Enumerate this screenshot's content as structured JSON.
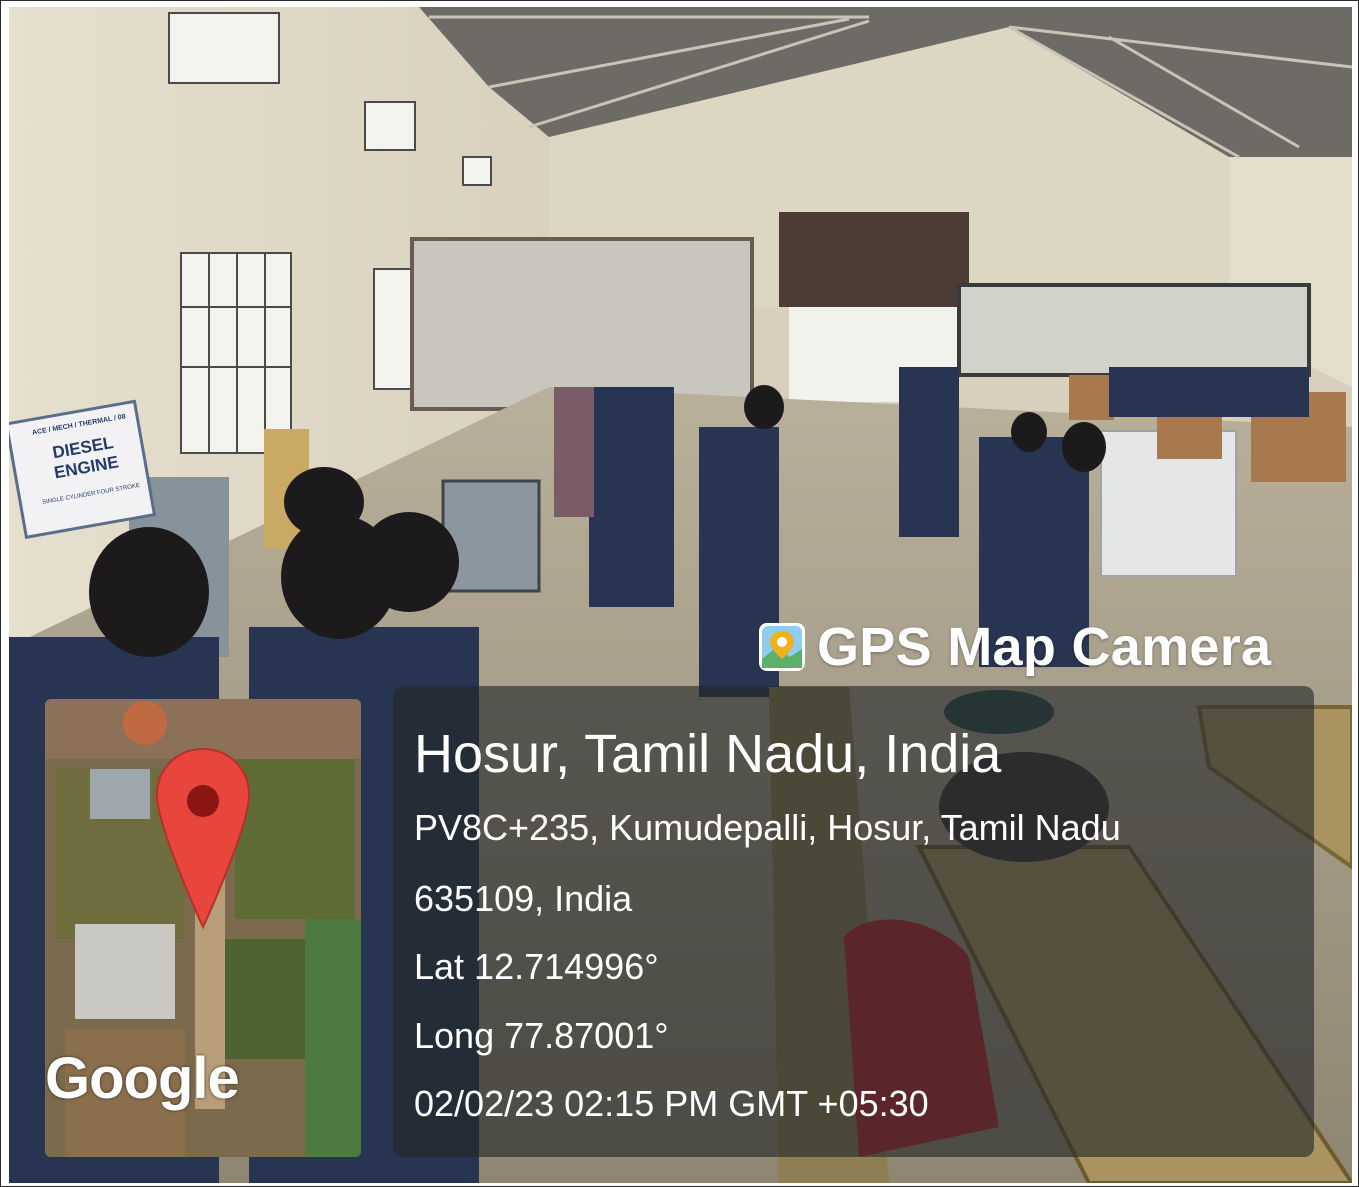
{
  "watermark": {
    "app_name": "GPS Map Camera",
    "place": "Hosur, Tamil Nadu, India",
    "address_line1": "PV8C+235, Kumudepalli, Hosur, Tamil Nadu",
    "address_line2": "635109, India",
    "latitude": "Lat 12.714996°",
    "longitude": "Long 77.87001°",
    "datetime": "02/02/23 02:15 PM GMT +05:30"
  },
  "photo_sign": {
    "line1": "ACE / MECH / THERMAL / 08",
    "line2": "DIESEL ENGINE",
    "line3": "SINGLE CYLINDER FOUR STROKE"
  },
  "map": {
    "provider_label": "Google",
    "pin_color": "#e8453c",
    "app_icon": "map-pin-camera-icon"
  }
}
